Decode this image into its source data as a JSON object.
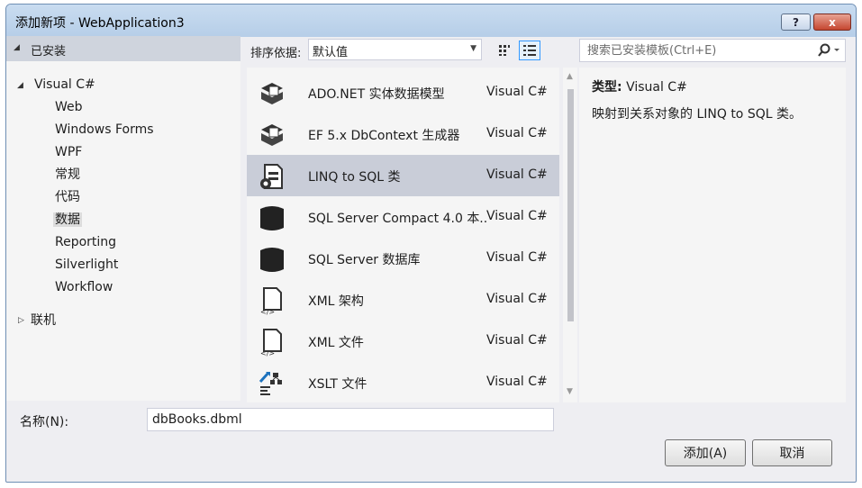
{
  "window": {
    "title": "添加新项 - WebApplication3",
    "help_label": "?",
    "close_label": "x"
  },
  "left": {
    "header": "已安装",
    "root": "Visual C#",
    "children": [
      "Web",
      "Windows Forms",
      "WPF",
      "常规",
      "代码",
      "数据",
      "Reporting",
      "Silverlight",
      "Workflow"
    ],
    "selected_child": "数据",
    "collapsed": "联机"
  },
  "toolbar": {
    "sort_label": "排序依据:",
    "sort_value": "默认值"
  },
  "search": {
    "placeholder": "搜索已安装模板(Ctrl+E)"
  },
  "items": [
    {
      "name": "ADO.NET 实体数据模型",
      "lang": "Visual C#",
      "icon": "entity-model-icon"
    },
    {
      "name": "EF 5.x DbContext 生成器",
      "lang": "Visual C#",
      "icon": "dbcontext-generator-icon"
    },
    {
      "name": "LINQ to SQL 类",
      "lang": "Visual C#",
      "icon": "linq-to-sql-icon"
    },
    {
      "name": "SQL Server Compact 4.0 本...",
      "lang": "Visual C#",
      "icon": "database-icon"
    },
    {
      "name": "SQL Server 数据库",
      "lang": "Visual C#",
      "icon": "database-icon"
    },
    {
      "name": "XML 架构",
      "lang": "Visual C#",
      "icon": "xml-file-icon"
    },
    {
      "name": "XML 文件",
      "lang": "Visual C#",
      "icon": "xml-file-icon"
    },
    {
      "name": "XSLT 文件",
      "lang": "Visual C#",
      "icon": "xslt-file-icon"
    }
  ],
  "selected_item_index": 2,
  "details": {
    "type_label": "类型:",
    "type_value": "Visual C#",
    "description": "映射到关系对象的 LINQ to SQL 类。"
  },
  "name_field": {
    "label": "名称(N):",
    "value": "dbBooks.dbml"
  },
  "buttons": {
    "add": "添加(A)",
    "cancel": "取消"
  }
}
